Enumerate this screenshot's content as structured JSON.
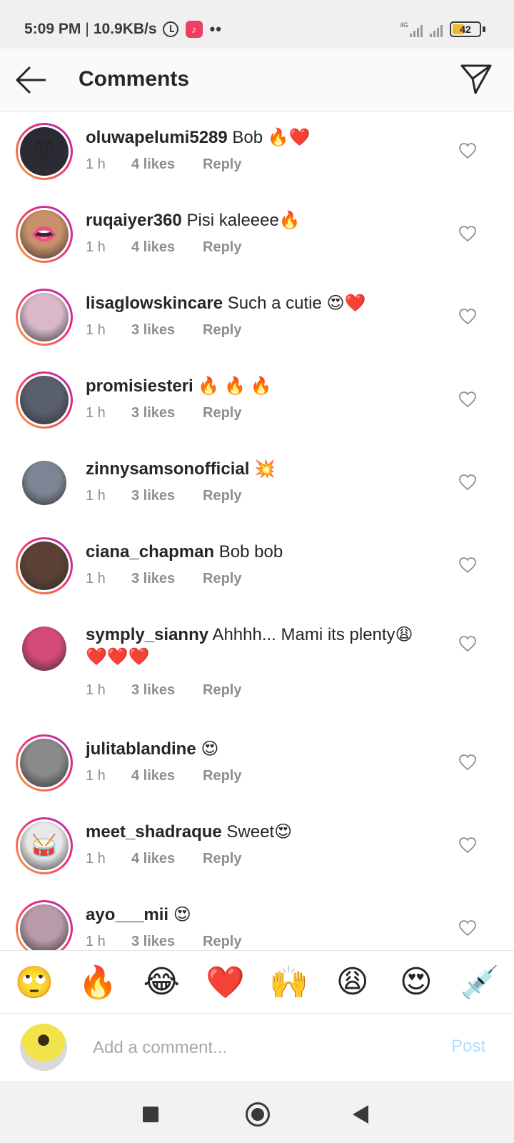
{
  "status_bar": {
    "time": "5:09 PM",
    "separator": "|",
    "speed": "10.9KB/s",
    "dots": "••",
    "network": "4G",
    "battery": "42",
    "battery_level": 0.42
  },
  "header": {
    "title": "Comments"
  },
  "comments": [
    {
      "user": "oluwapelumi5289",
      "text": "Bob 🔥❤️",
      "time": "1 h",
      "likes": "4 likes",
      "reply": "Reply",
      "story": true,
      "avatar_color": "#2a2a35",
      "avatar_emoji": "😈"
    },
    {
      "user": "ruqaiyer360",
      "text": "Pisi kaleeee🔥",
      "time": "1 h",
      "likes": "4 likes",
      "reply": "Reply",
      "story": true,
      "avatar_color": "#c9906a",
      "avatar_emoji": "👄"
    },
    {
      "user": "lisaglowskincare",
      "text": "Such a cutie 😍❤️",
      "time": "1 h",
      "likes": "3 likes",
      "reply": "Reply",
      "story": true,
      "avatar_color": "#d9b9c9",
      "avatar_emoji": ""
    },
    {
      "user": "promisiesteri",
      "text": "🔥 🔥 🔥",
      "time": "1 h",
      "likes": "3 likes",
      "reply": "Reply",
      "story": true,
      "avatar_color": "#5a5f6e",
      "avatar_emoji": ""
    },
    {
      "user": "zinnysamsonofficial",
      "text": "💥",
      "time": "1 h",
      "likes": "3 likes",
      "reply": "Reply",
      "story": false,
      "avatar_color": "#7d8594",
      "avatar_emoji": ""
    },
    {
      "user": "ciana_chapman",
      "text": "Bob bob",
      "time": "1 h",
      "likes": "3 likes",
      "reply": "Reply",
      "story": true,
      "avatar_color": "#5a4134",
      "avatar_emoji": ""
    },
    {
      "user": "symply_sianny",
      "text": "Ahhhh... Mami its plenty😩 ❤️❤️❤️",
      "time": "1 h",
      "likes": "3 likes",
      "reply": "Reply",
      "story": false,
      "avatar_color": "#d4487a",
      "avatar_emoji": ""
    },
    {
      "user": "julitablandine",
      "text": "😍",
      "time": "1 h",
      "likes": "4 likes",
      "reply": "Reply",
      "story": true,
      "avatar_color": "#8a8a8a",
      "avatar_emoji": ""
    },
    {
      "user": "meet_shadraque",
      "text": "Sweet😍",
      "time": "1 h",
      "likes": "4 likes",
      "reply": "Reply",
      "story": true,
      "avatar_color": "#e8e8e8",
      "avatar_emoji": "🥁"
    },
    {
      "user": "ayo___mii",
      "text": "😍",
      "time": "1 h",
      "likes": "3 likes",
      "reply": "Reply",
      "story": true,
      "avatar_color": "#b89aa8",
      "avatar_emoji": ""
    }
  ],
  "emoji_bar": [
    "🙄",
    "🔥",
    "😂",
    "❤️",
    "🙌",
    "😩",
    "😍",
    "💉"
  ],
  "composer": {
    "placeholder": "Add a comment...",
    "post_label": "Post"
  },
  "colors": {
    "accent_post_disabled": "#b3dbff",
    "meta_gray": "#8e8e8e",
    "text": "#262626"
  }
}
